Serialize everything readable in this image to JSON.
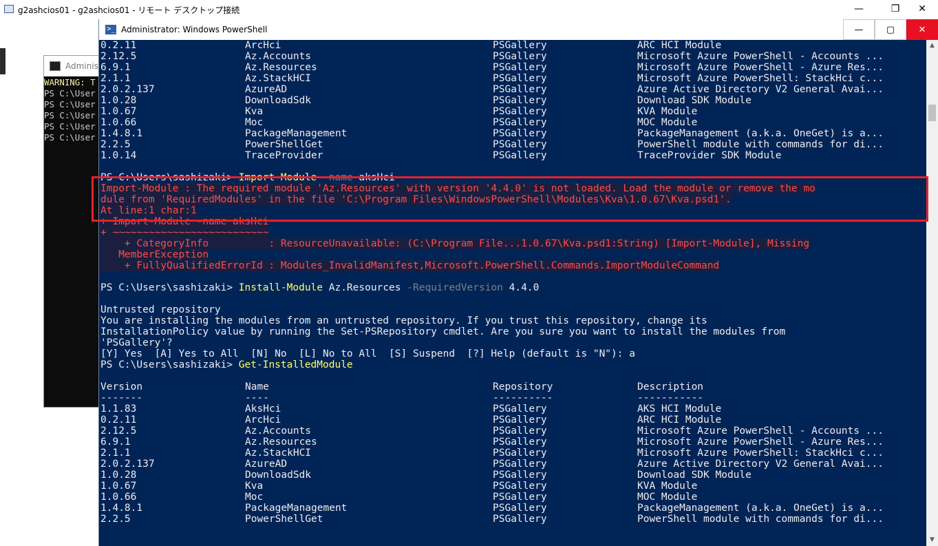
{
  "remote_window": {
    "title": "g2ashcios01 - g2ashcios01 - リモート デスクトップ接続",
    "minimize": "—",
    "maximize": "❐",
    "close": "✕"
  },
  "cmd_window": {
    "title": "Administ",
    "lines": [
      {
        "text": "WARNING: T",
        "color": "#f9f1a5"
      },
      {
        "text": "PS C:\\User",
        "color": "#cccccc"
      },
      {
        "text": "PS C:\\User",
        "color": "#cccccc"
      },
      {
        "text": "PS C:\\User",
        "color": "#cccccc"
      },
      {
        "text": "PS C:\\User",
        "color": "#cccccc"
      },
      {
        "text": "PS C:\\User",
        "color": "#cccccc"
      }
    ]
  },
  "ps_window": {
    "title": "Administrator: Windows PowerShell",
    "minimize": "—",
    "maximize": "▢",
    "close": "✕"
  },
  "colors": {
    "ps_background": "#012456",
    "ps_text": "#eeedf0",
    "error_text": "#ff4b4b",
    "command_text": "#ffff66",
    "parameter_text": "#808080",
    "highlight_border": "#e8202a"
  },
  "console": {
    "top_rows": [
      {
        "version": "0.2.11",
        "name": "ArcHci",
        "repository": "PSGallery",
        "description": "ARC HCI Module"
      },
      {
        "version": "2.12.5",
        "name": "Az.Accounts",
        "repository": "PSGallery",
        "description": "Microsoft Azure PowerShell - Accounts ..."
      },
      {
        "version": "6.9.1",
        "name": "Az.Resources",
        "repository": "PSGallery",
        "description": "Microsoft Azure PowerShell - Azure Res..."
      },
      {
        "version": "2.1.1",
        "name": "Az.StackHCI",
        "repository": "PSGallery",
        "description": "Microsoft Azure PowerShell: StackHci c..."
      },
      {
        "version": "2.0.2.137",
        "name": "AzureAD",
        "repository": "PSGallery",
        "description": "Azure Active Directory V2 General Avai..."
      },
      {
        "version": "1.0.28",
        "name": "DownloadSdk",
        "repository": "PSGallery",
        "description": "Download SDK Module"
      },
      {
        "version": "1.0.67",
        "name": "Kva",
        "repository": "PSGallery",
        "description": "KVA Module"
      },
      {
        "version": "1.0.66",
        "name": "Moc",
        "repository": "PSGallery",
        "description": "MOC Module"
      },
      {
        "version": "1.4.8.1",
        "name": "PackageManagement",
        "repository": "PSGallery",
        "description": "PackageManagement (a.k.a. OneGet) is a..."
      },
      {
        "version": "2.2.5",
        "name": "PowerShellGet",
        "repository": "PSGallery",
        "description": "PowerShell module with commands for di..."
      },
      {
        "version": "1.0.14",
        "name": "TraceProvider",
        "repository": "PSGallery",
        "description": "TraceProvider SDK Module"
      }
    ],
    "prompt": "PS C:\\Users\\sashizaki> ",
    "import_cmd": "Import-Module",
    "import_param": " -name",
    "import_arg": " aksHci",
    "error_lines": [
      "Import-Module : The required module 'Az.Resources' with version '4.4.0' is not loaded. Load the module or remove the mo",
      "dule from 'RequiredModules' in the file 'C:\\Program Files\\WindowsPowerShell\\Modules\\Kva\\1.0.67\\Kva.psd1'.",
      "At line:1 char:1",
      "+ Import-Module -name aksHci",
      "+ ~~~~~~~~~~~~~~~~~~~~~~~~~~",
      "    + CategoryInfo          : ResourceUnavailable: (C:\\Program File...1.0.67\\Kva.psd1:String) [Import-Module], Missing",
      "   MemberException",
      "    + FullyQualifiedErrorId : Modules_InvalidManifest,Microsoft.PowerShell.Commands.ImportModuleCommand"
    ],
    "install_cmd": "Install-Module",
    "install_arg1": " Az.Resources",
    "install_param": " -RequiredVersion",
    "install_arg2": " 4.4.0",
    "untrusted_lines": [
      "Untrusted repository",
      "You are installing the modules from an untrusted repository. If you trust this repository, change its",
      "InstallationPolicy value by running the Set-PSRepository cmdlet. Are you sure you want to install the modules from",
      "'PSGallery'?",
      "[Y] Yes  [A] Yes to All  [N] No  [L] No to All  [S] Suspend  [?] Help (default is \"N\"): a"
    ],
    "get_cmd": "Get-InstalledModule",
    "headers": {
      "version": "Version",
      "name": "Name",
      "repository": "Repository",
      "description": "Description"
    },
    "underlines": {
      "version": "-------",
      "name": "----",
      "repository": "----------",
      "description": "-----------"
    },
    "bottom_rows": [
      {
        "version": "1.1.83",
        "name": "AksHci",
        "repository": "PSGallery",
        "description": "AKS HCI Module"
      },
      {
        "version": "0.2.11",
        "name": "ArcHci",
        "repository": "PSGallery",
        "description": "ARC HCI Module"
      },
      {
        "version": "2.12.5",
        "name": "Az.Accounts",
        "repository": "PSGallery",
        "description": "Microsoft Azure PowerShell - Accounts ..."
      },
      {
        "version": "6.9.1",
        "name": "Az.Resources",
        "repository": "PSGallery",
        "description": "Microsoft Azure PowerShell - Azure Res..."
      },
      {
        "version": "2.1.1",
        "name": "Az.StackHCI",
        "repository": "PSGallery",
        "description": "Microsoft Azure PowerShell: StackHci c..."
      },
      {
        "version": "2.0.2.137",
        "name": "AzureAD",
        "repository": "PSGallery",
        "description": "Azure Active Directory V2 General Avai..."
      },
      {
        "version": "1.0.28",
        "name": "DownloadSdk",
        "repository": "PSGallery",
        "description": "Download SDK Module"
      },
      {
        "version": "1.0.67",
        "name": "Kva",
        "repository": "PSGallery",
        "description": "KVA Module"
      },
      {
        "version": "1.0.66",
        "name": "Moc",
        "repository": "PSGallery",
        "description": "MOC Module"
      },
      {
        "version": "1.4.8.1",
        "name": "PackageManagement",
        "repository": "PSGallery",
        "description": "PackageManagement (a.k.a. OneGet) is a..."
      },
      {
        "version": "2.2.5",
        "name": "PowerShellGet",
        "repository": "PSGallery",
        "description": "PowerShell module with commands for di..."
      }
    ]
  }
}
